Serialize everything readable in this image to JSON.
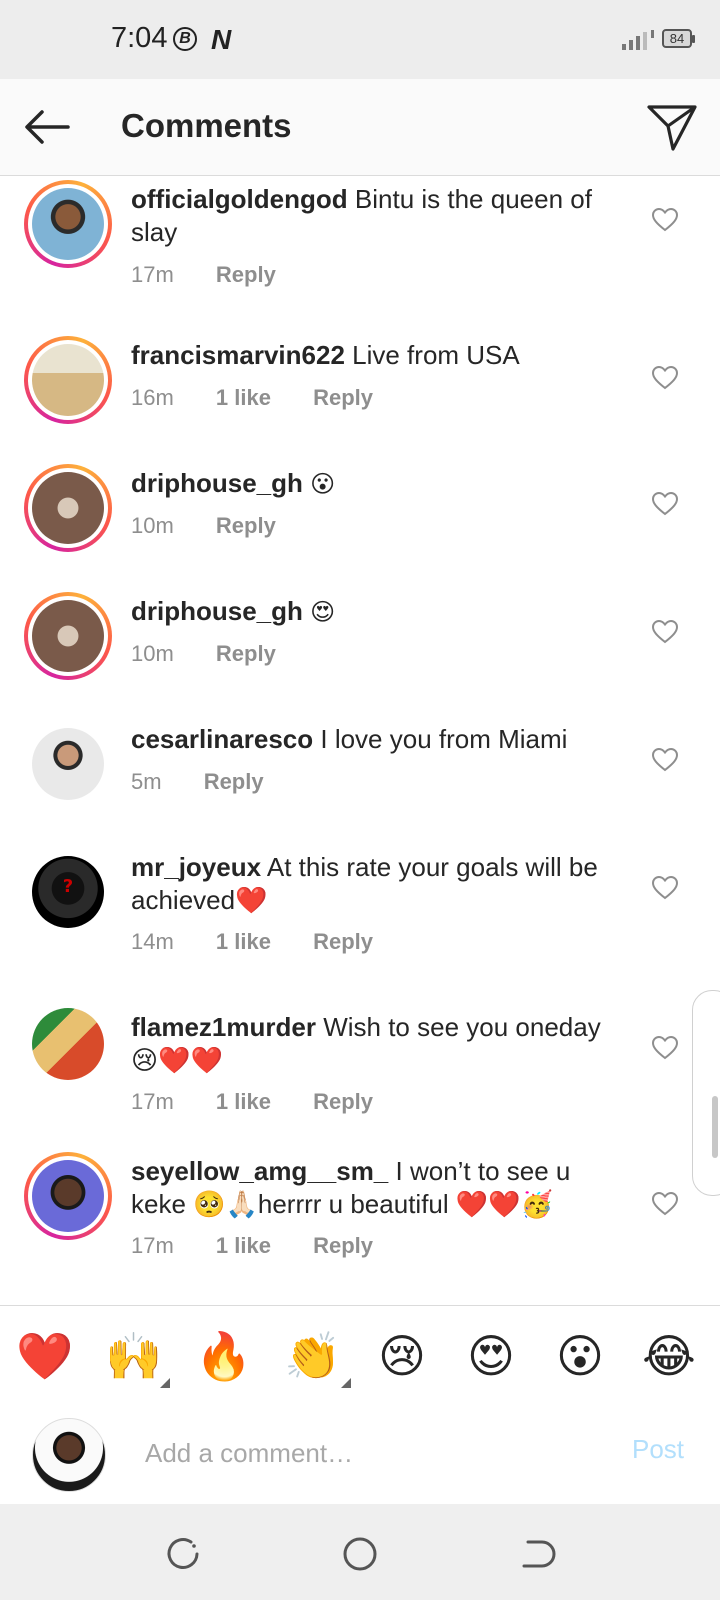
{
  "status_bar": {
    "time": "7:04",
    "battery": "84",
    "icon_b": "B",
    "icon_n": "N"
  },
  "header": {
    "title": "Comments"
  },
  "comments": [
    {
      "username": "officialgoldengod",
      "text": "Bintu is the queen of slay",
      "time": "17m",
      "likes": "",
      "reply": "Reply"
    },
    {
      "username": "francismarvin622",
      "text": "Live from USA",
      "time": "16m",
      "likes": "1 like",
      "reply": "Reply"
    },
    {
      "username": "driphouse_gh",
      "text": "😮",
      "time": "10m",
      "likes": "",
      "reply": "Reply"
    },
    {
      "username": "driphouse_gh",
      "text": "😍",
      "time": "10m",
      "likes": "",
      "reply": "Reply"
    },
    {
      "username": "cesarlinaresco",
      "text": "I love you from Miami",
      "time": "5m",
      "likes": "",
      "reply": "Reply"
    },
    {
      "username": "mr_joyeux",
      "text": "At this rate your goals will be achieved❤️",
      "time": "14m",
      "likes": "1 like",
      "reply": "Reply"
    },
    {
      "username": "flamez1murder",
      "text": "Wish to see you oneday 😢❤️❤️",
      "time": "17m",
      "likes": "1 like",
      "reply": "Reply"
    },
    {
      "username": "seyellow_amg__sm_",
      "text": "I won’t to see u keke 🥺🙏🏻herrrr u beautiful ❤️❤️🥳",
      "time": "17m",
      "likes": "1 like",
      "reply": "Reply"
    }
  ],
  "emoji_bar": [
    "❤️",
    "🙌",
    "🔥",
    "👏",
    "😢",
    "😍",
    "😮",
    "😂"
  ],
  "composer": {
    "placeholder": "Add a comment…",
    "post_label": "Post"
  },
  "colors": {
    "accent_post_disabled": "#b2dffc",
    "meta_gray": "#8e8e8e",
    "ring_start": "#d6249f",
    "ring_end": "#fdb13b"
  }
}
